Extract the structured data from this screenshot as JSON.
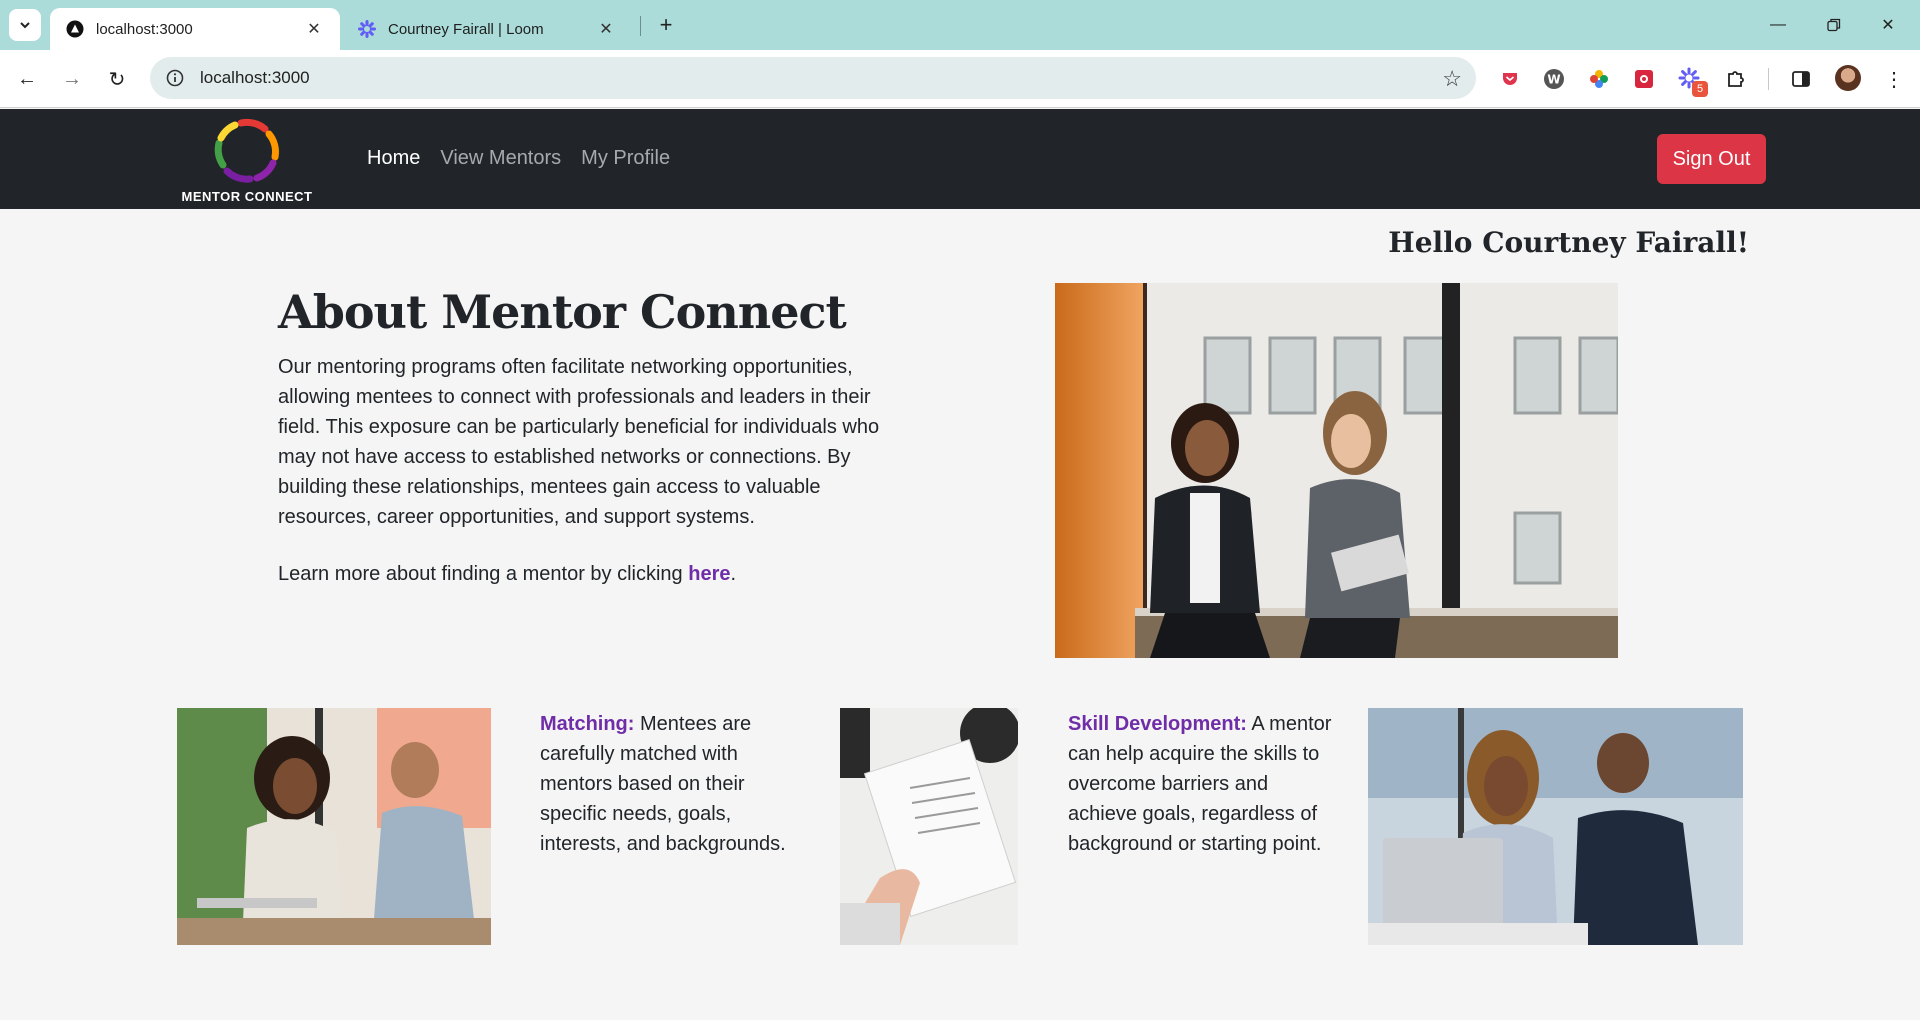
{
  "browser": {
    "tabs": [
      {
        "title": "localhost:3000",
        "active": true
      },
      {
        "title": "Courtney Fairall | Loom",
        "active": false
      }
    ],
    "url": "localhost:3000",
    "extension_badge": "5"
  },
  "nav": {
    "brand": "MENTOR CONNECT",
    "links": [
      "Home",
      "View Mentors",
      "My Profile"
    ],
    "sign_out": "Sign Out"
  },
  "page": {
    "greeting": "Hello Courtney Fairall!",
    "about_title": "About Mentor Connect",
    "about_body": "Our mentoring programs often facilitate networking opportunities, allowing mentees to connect with professionals and leaders in their field. This exposure can be particularly beneficial for individuals who may not have access to established networks or connections. By building these relationships, mentees gain access to valuable resources, career opportunities, and support systems.",
    "learn_prefix": "Learn more about finding a mentor by clicking ",
    "learn_link": "here",
    "learn_suffix": ".",
    "features": [
      {
        "keyword": "Matching:",
        "text": " Mentees are carefully matched with mentors based on their specific needs, goals, interests, and backgrounds."
      },
      {
        "keyword": "Skill Development:",
        "text": " A mentor can help acquire the skills to overcome barriers and achieve goals, regardless of background or starting point."
      }
    ]
  },
  "colors": {
    "navbar_bg": "#212529",
    "accent_purple": "#6f2da8",
    "danger": "#dc3545",
    "tabstrip": "#abdcd9"
  }
}
